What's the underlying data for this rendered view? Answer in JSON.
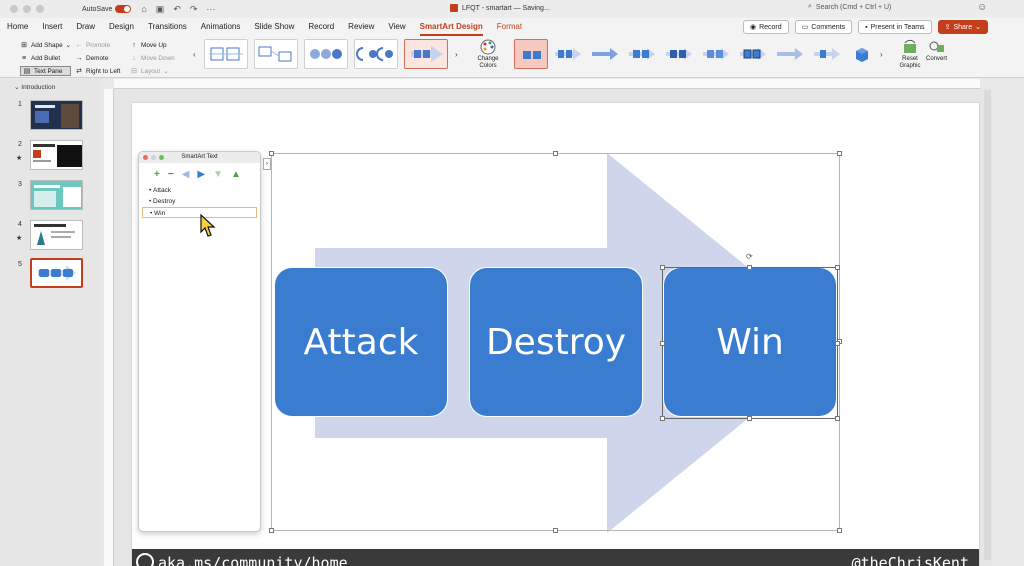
{
  "titlebar": {
    "autosave_label": "AutoSave",
    "document_title": "LFQT - smartart — Saving...",
    "search_placeholder": "Search (Cmd + Ctrl + U)"
  },
  "tabs": [
    "Home",
    "Insert",
    "Draw",
    "Design",
    "Transitions",
    "Animations",
    "Slide Show",
    "Record",
    "Review",
    "View",
    "SmartArt Design",
    "Format"
  ],
  "tab_actions": {
    "record": "Record",
    "comments": "Comments",
    "present_in_teams": "Present in Teams",
    "share": "Share"
  },
  "ribbon": {
    "create": {
      "add_shape": "Add Shape",
      "add_bullet": "Add Bullet",
      "text_pane": "Text Pane",
      "promote": "Promote",
      "demote": "Demote",
      "right_to_left": "Right to Left",
      "move_up": "Move Up",
      "move_down": "Move Down",
      "layout": "Layout"
    },
    "change_colors": "Change Colors",
    "reset_graphic": "Reset Graphic",
    "convert": "Convert"
  },
  "thumbnails": {
    "section": "Introduction",
    "slides": [
      "1",
      "2",
      "3",
      "4",
      "5"
    ]
  },
  "text_pane": {
    "title": "SmartArt Text",
    "items": [
      "Attack",
      "Destroy",
      "Win"
    ]
  },
  "smartart": {
    "boxes": [
      "Attack",
      "Destroy",
      "Win"
    ]
  },
  "footer": {
    "left": "aka.ms/community/home",
    "right": "@theChrisKent"
  },
  "colors": {
    "accent": "#c43e1c",
    "smartart_box": "#3a7cd0",
    "smartart_arrow": "#cfd6ec"
  }
}
